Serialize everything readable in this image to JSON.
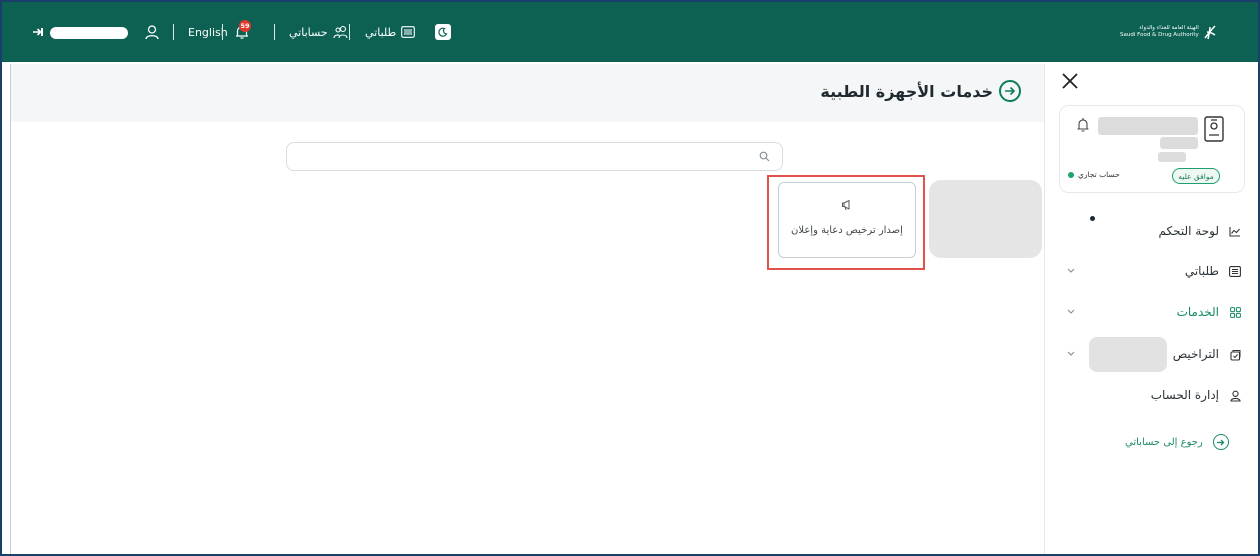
{
  "header": {
    "language_label": "English",
    "notification_count": "59",
    "accounts_label": "حساباتي",
    "requests_label": "طلباتي",
    "logo_line1": "الهيئة العامة للغذاء والدواء",
    "logo_line2": "Saudi Food & Drug Authority"
  },
  "main": {
    "page_title": "خدمات الأجهزة الطبية",
    "search_placeholder": "",
    "service_card_label": "إصدار ترخيص دعاية وإعلان"
  },
  "sidebar": {
    "account_type": "حساب تجاري",
    "status_badge": "موافق عليه",
    "items": [
      {
        "label": "لوحة التحكم",
        "icon": "chart-line-icon"
      },
      {
        "label": "طلباتي",
        "icon": "list-icon"
      },
      {
        "label": "الخدمات",
        "icon": "grid-icon"
      },
      {
        "label": "التراخيص",
        "icon": "license-icon"
      },
      {
        "label": "إدارة الحساب",
        "icon": "user-icon"
      }
    ],
    "back_link": "رجوع إلى حساباتي"
  },
  "colors": {
    "header_bg": "#0c6153",
    "accent_green": "#138a5e",
    "badge_red": "#e0392b",
    "highlight_red": "#e2524a"
  }
}
